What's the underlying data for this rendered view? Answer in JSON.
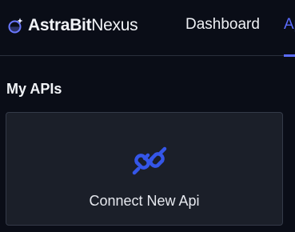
{
  "brand": {
    "name_bold": "AstraBit",
    "name_light": "Nexus",
    "logo_icon": "astrabit-planet-logo-icon"
  },
  "nav": {
    "items": [
      {
        "label": "Dashboard",
        "active": false
      },
      {
        "label": "Ap",
        "active": true
      }
    ]
  },
  "main": {
    "section_title": "My APIs",
    "connect_card": {
      "label": "Connect New Api",
      "icon": "plug-connect-icon"
    }
  },
  "colors": {
    "background": "#0a0d17",
    "card": "#1b1f29",
    "accent": "#5b6cff",
    "icon_blue": "#3556e8"
  }
}
